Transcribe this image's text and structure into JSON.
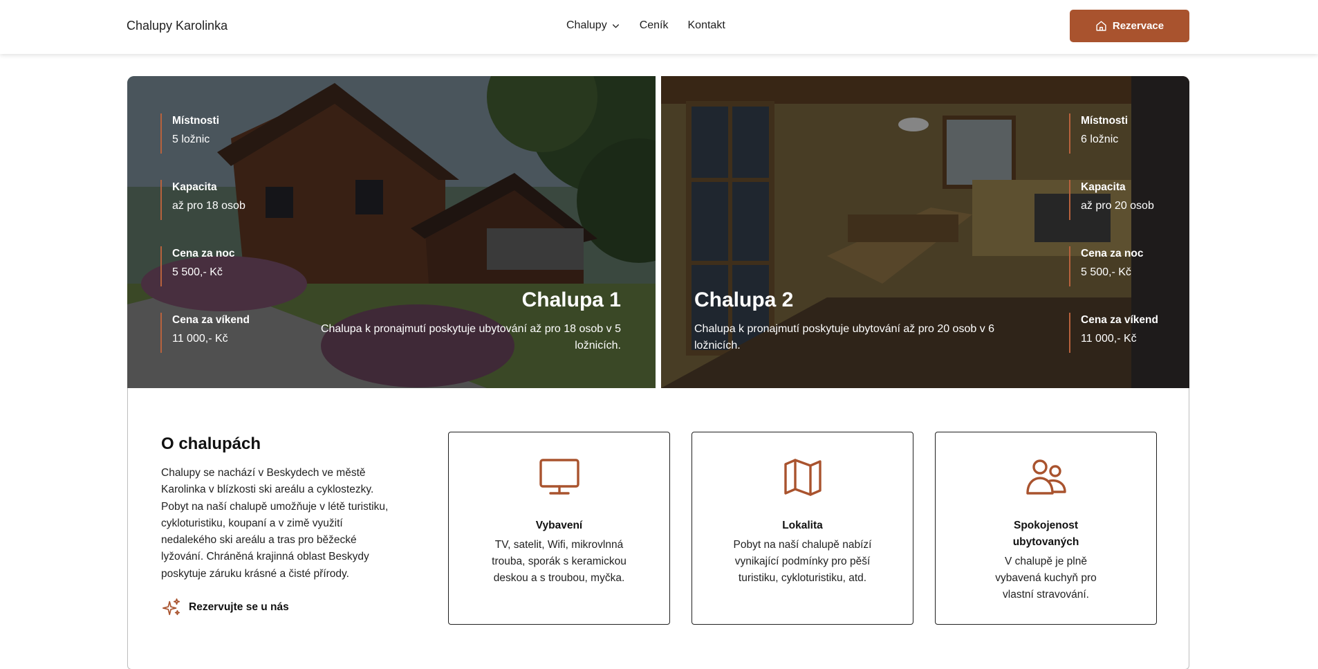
{
  "header": {
    "logo": "Chalupy Karolinka",
    "nav": [
      {
        "label": "Chalupy",
        "has_dropdown": true
      },
      {
        "label": "Ceník"
      },
      {
        "label": "Kontakt"
      }
    ],
    "cta_label": "Rezervace"
  },
  "cabins": [
    {
      "title": "Chalupa 1",
      "description": "Chalupa k pronajmutí poskytuje ubytování až pro 18 osob v 5 ložnicích.",
      "specs": [
        {
          "label": "Místnosti",
          "value": "5 ložnic"
        },
        {
          "label": "Kapacita",
          "value": "až pro 18 osob"
        },
        {
          "label": "Cena za noc",
          "value": "5 500,- Kč"
        },
        {
          "label": "Cena za víkend",
          "value": "11 000,- Kč"
        }
      ]
    },
    {
      "title": "Chalupa 2",
      "description": "Chalupa k pronajmutí poskytuje ubytování až pro 20 osob v 6 ložnicích.",
      "specs": [
        {
          "label": "Místnosti",
          "value": "6 ložnic"
        },
        {
          "label": "Kapacita",
          "value": "až pro 20 osob"
        },
        {
          "label": "Cena za noc",
          "value": "5 500,- Kč"
        },
        {
          "label": "Cena za víkend",
          "value": "11 000,- Kč"
        }
      ]
    }
  ],
  "about": {
    "title": "O chalupách",
    "text": "Chalupy se nachází v Beskydech ve městě Karolinka v blízkosti ski areálu a cyklostezky. Pobyt na naší chalupě umožňuje v létě turistiku, cykloturistiku, koupaní a v zimě využití nedalekého ski areálu a tras pro běžecké lyžování. Chráněná krajinná oblast Beskydy poskytuje záruku krásné a čisté přírody.",
    "link_label": "Rezervujte se u nás"
  },
  "features": [
    {
      "icon": "monitor-icon",
      "title": "Vybavení",
      "description": "TV, satelit, Wifi, mikrovlnná trouba, sporák s keramickou deskou a s troubou, myčka."
    },
    {
      "icon": "map-icon",
      "title": "Lokalita",
      "description": "Pobyt na naší chalupě nabízí vynikající podmínky pro pěší turistiku, cykloturistiku, atd."
    },
    {
      "icon": "users-icon",
      "title": "Spokojenost ubytovaných",
      "description": "V chalupě je plně vybavená kuchyň pro vlastní stravování."
    }
  ],
  "colors": {
    "accent": "#a9532e",
    "spec_border": "#b8623d",
    "icon": "#a9532e"
  }
}
